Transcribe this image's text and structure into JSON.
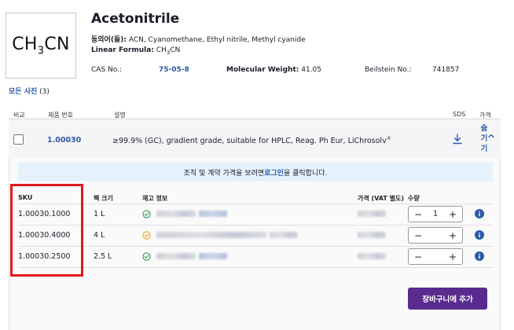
{
  "product": {
    "structure_main": "CH",
    "structure_sub": "3",
    "structure_end": "CN",
    "name": "Acetonitrile",
    "synonyms_label": "동의어(들):",
    "synonyms_value": " ACN, Cyanomethane, Ethyl nitrile, Methyl cyanide",
    "linear_formula_label": "Linear Formula:",
    "linear_formula_main": " CH",
    "linear_formula_sub": "3",
    "linear_formula_end": "CN",
    "cas_label": "CAS No.:",
    "cas_value": "75-05-8",
    "mw_label": "Molecular Weight:",
    "mw_value": " 41.05",
    "beilstein_label": "Beilstein No.:",
    "beilstein_value": "741857",
    "all_photos_label": "모든 사진",
    "all_photos_count": " (3)"
  },
  "table_headers": {
    "compare": "비교",
    "product_no": "제품 번호",
    "description": "설명",
    "sds": "SDS",
    "price": "가격"
  },
  "product_row": {
    "number": "1.00030",
    "description": "≥99.9% (GC), gradient grade, suitable for HPLC, Reag. Ph Eur, LiChrosolv",
    "description_sup": "®",
    "hide_1": "숨",
    "hide_2": "기",
    "hide_3": "기"
  },
  "banner": {
    "before": "조직 및 계약 가격을 보려면 ",
    "link": "로그인",
    "after": "을 클릭합니다."
  },
  "sku_headers": {
    "sku": "SKU",
    "pack_size": "팩 크기",
    "stock": "재고 정보",
    "price": "가격 (VAT 별도)",
    "quantity": "수량"
  },
  "sku_rows": [
    {
      "sku": "1.00030.1000",
      "size": "1 L",
      "qty": "1",
      "stock_status": "available"
    },
    {
      "sku": "1.00030.4000",
      "size": "4 L",
      "qty": "",
      "stock_status": "limited"
    },
    {
      "sku": "1.00030.2500",
      "size": "2.5 L",
      "qty": "",
      "stock_status": "available"
    }
  ],
  "stepper": {
    "minus": "−",
    "plus": "+"
  },
  "cart_button": "장바구니에 추가",
  "colors": {
    "link_blue": "#2a5aa8",
    "cart_purple": "#5a2b8e",
    "available_green": "#2e9e4f",
    "limited_orange": "#f0a21a",
    "highlight_red": "#e0191f"
  },
  "icons": {
    "sds": "download-icon",
    "chevron": "chevron-up-icon",
    "available": "check-circle-icon",
    "limited": "check-circle-icon",
    "info": "info-icon"
  }
}
